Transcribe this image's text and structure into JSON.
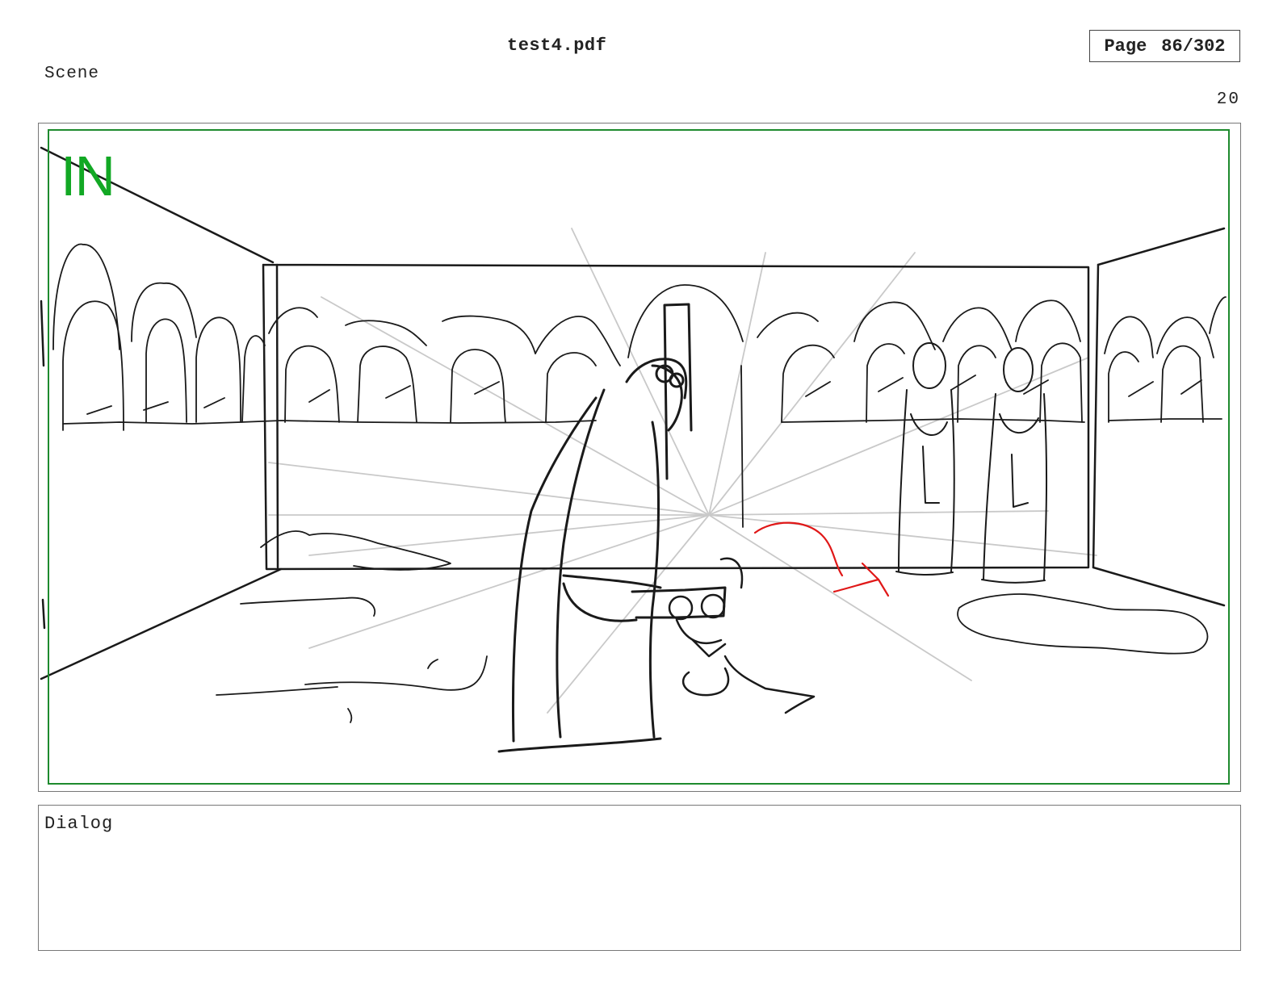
{
  "header": {
    "document_title": "test4.pdf",
    "page_label": "Page",
    "page_value": "86/302"
  },
  "scene": {
    "label": "Scene",
    "number": "20"
  },
  "panel": {
    "transition_label": "IN",
    "transition_color": "#12a824",
    "safe_frame_color": "#1e8a2e",
    "direction_arrow_color": "#e01818"
  },
  "dialog": {
    "label": "Dialog"
  }
}
